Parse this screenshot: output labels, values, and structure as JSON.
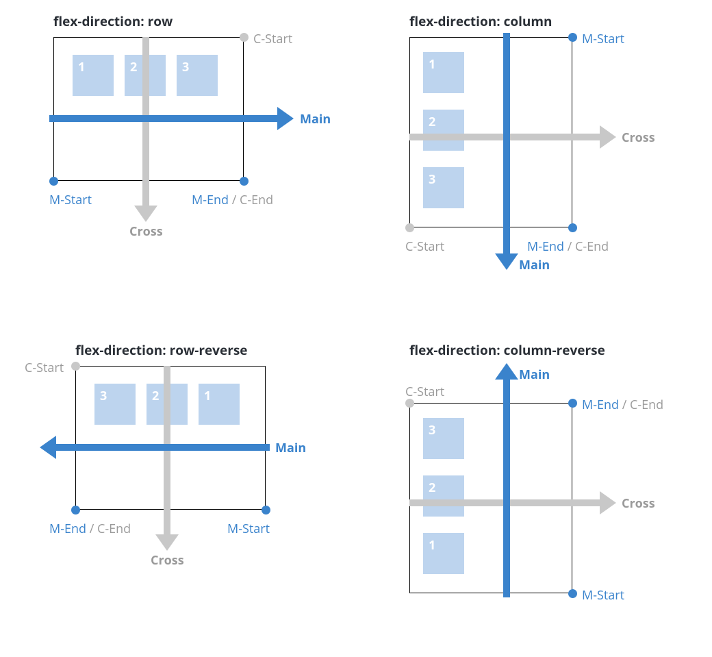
{
  "colors": {
    "blue": "#3a83cc",
    "grey": "#c8c8c8",
    "itemBg": "#bdd4ee",
    "text": "#2a2f36"
  },
  "labels": {
    "main": "Main",
    "cross": "Cross",
    "mStart": "M-Start",
    "mEnd": "M-End",
    "cStart": "C-Start",
    "cEnd": "C-End"
  },
  "panels": {
    "row": {
      "heading": "flex-direction: row",
      "items": [
        "1",
        "2",
        "3"
      ]
    },
    "column": {
      "heading": "flex-direction: column",
      "items": [
        "1",
        "2",
        "3"
      ]
    },
    "rowReverse": {
      "heading": "flex-direction: row-reverse",
      "items": [
        "3",
        "2",
        "1"
      ]
    },
    "columnReverse": {
      "heading": "flex-direction: column-reverse",
      "items": [
        "3",
        "2",
        "1"
      ]
    }
  }
}
